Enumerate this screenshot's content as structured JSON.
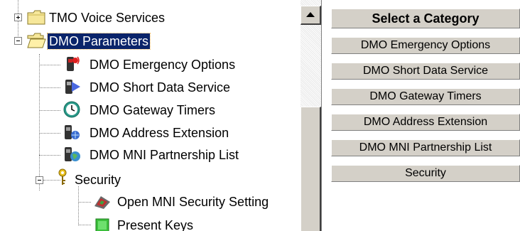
{
  "tree": {
    "items": [
      {
        "label": "TMO Voice Services",
        "icon": "closed-folder-icon"
      },
      {
        "label": "DMO Parameters",
        "icon": "open-folder-icon",
        "selected": true
      },
      {
        "label": "DMO Emergency Options",
        "icon": "emergency-radio-icon"
      },
      {
        "label": "DMO Short Data Service",
        "icon": "sds-radio-icon"
      },
      {
        "label": "DMO Gateway Timers",
        "icon": "clock-icon"
      },
      {
        "label": "DMO Address Extension",
        "icon": "address-radio-icon"
      },
      {
        "label": "DMO MNI Partnership List",
        "icon": "globe-radio-icon"
      },
      {
        "label": "Security",
        "icon": "key-icon"
      },
      {
        "label": "Open MNI Security Setting",
        "icon": "security-setting-icon"
      },
      {
        "label": "Present Keys",
        "icon": "green-key-block-icon"
      }
    ]
  },
  "categories": {
    "header": "Select a Category",
    "buttons": [
      "DMO Emergency Options",
      "DMO Short Data Service",
      "DMO Gateway Timers",
      "DMO Address Extension",
      "DMO MNI Partnership List",
      "Security"
    ]
  },
  "colors": {
    "selection": "#0a246a",
    "face": "#d4d0c8"
  }
}
